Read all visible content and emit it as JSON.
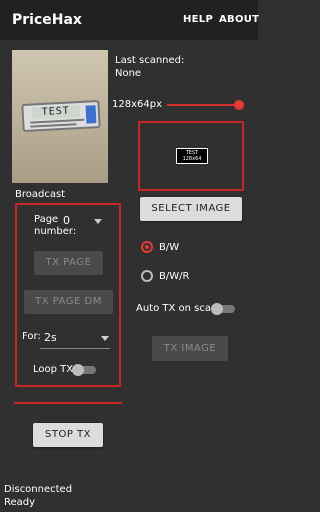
{
  "appbar": {
    "title": "PriceHax",
    "help": "HELP",
    "about": "ABOUT"
  },
  "scan": {
    "photo_tag_text": "TEST",
    "last_scanned_label": "Last scanned:",
    "last_scanned_value": "None",
    "resolution": "128x64px",
    "resolution_slider_fraction": 1.0,
    "preview_line1": "TEST",
    "preview_line2": "128x64",
    "select_image": "SELECT IMAGE"
  },
  "broadcast": {
    "title": "Broadcast",
    "page_label": "Page number:",
    "page_value": "0",
    "tx_page": "TX PAGE",
    "tx_page_dm": "TX PAGE DM",
    "for_label": "For:",
    "for_value": "2s",
    "loop_label": "Loop TX",
    "loop_on": false
  },
  "color_mode": {
    "options": [
      "B/W",
      "B/W/R"
    ],
    "selected": "B/W"
  },
  "auto_tx": {
    "label": "Auto TX on scan",
    "on": false
  },
  "tx_image": "TX IMAGE",
  "stop_tx": "STOP TX",
  "status": {
    "line1": "Disconnected",
    "line2": "Ready"
  },
  "colors": {
    "accent": "#e53935",
    "border": "#c62828",
    "background": "#303030",
    "appbar": "#212121"
  }
}
